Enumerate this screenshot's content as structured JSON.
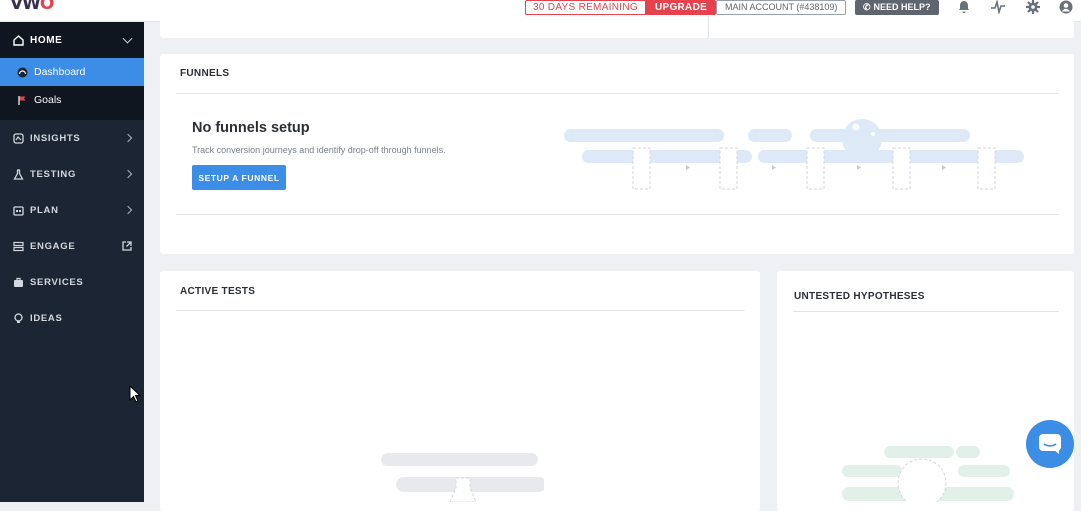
{
  "app": {
    "logo_main": "VW",
    "logo_accent": "O"
  },
  "topbar": {
    "trial_text": "30 DAYS REMAINING",
    "upgrade_label": "UPGRADE",
    "account_label": "MAIN ACCOUNT (#438109)",
    "help_label": "NEED HELP?",
    "icons": [
      "bell-icon",
      "activity-icon",
      "gear-icon",
      "user-icon"
    ]
  },
  "sidebar": {
    "home_label": "HOME",
    "home_items": [
      {
        "label": "Dashboard",
        "icon": "dashboard-icon",
        "active": true
      },
      {
        "label": "Goals",
        "icon": "flag-icon",
        "active": false
      }
    ],
    "items": [
      {
        "label": "INSIGHTS",
        "icon": "insights-icon",
        "trailing": "chevron"
      },
      {
        "label": "TESTING",
        "icon": "flask-icon",
        "trailing": "chevron"
      },
      {
        "label": "PLAN",
        "icon": "calendar-icon",
        "trailing": "chevron"
      },
      {
        "label": "ENGAGE",
        "icon": "engage-icon",
        "trailing": "external-link"
      },
      {
        "label": "SERVICES",
        "icon": "briefcase-icon",
        "trailing": ""
      },
      {
        "label": "IDEAS",
        "icon": "bulb-icon",
        "trailing": ""
      }
    ]
  },
  "funnels": {
    "title": "FUNNELS",
    "empty_heading": "No funnels setup",
    "empty_desc": "Track conversion journeys and identify drop-off through funnels.",
    "button_label": "SETUP A FUNNEL"
  },
  "active_tests": {
    "title": "ACTIVE TESTS"
  },
  "hypotheses": {
    "title": "UNTESTED HYPOTHESES"
  },
  "colors": {
    "accent": "#3b8de6",
    "danger": "#e5424d",
    "sidebar": "#1c2533",
    "sidebar_dark": "#10161f"
  }
}
